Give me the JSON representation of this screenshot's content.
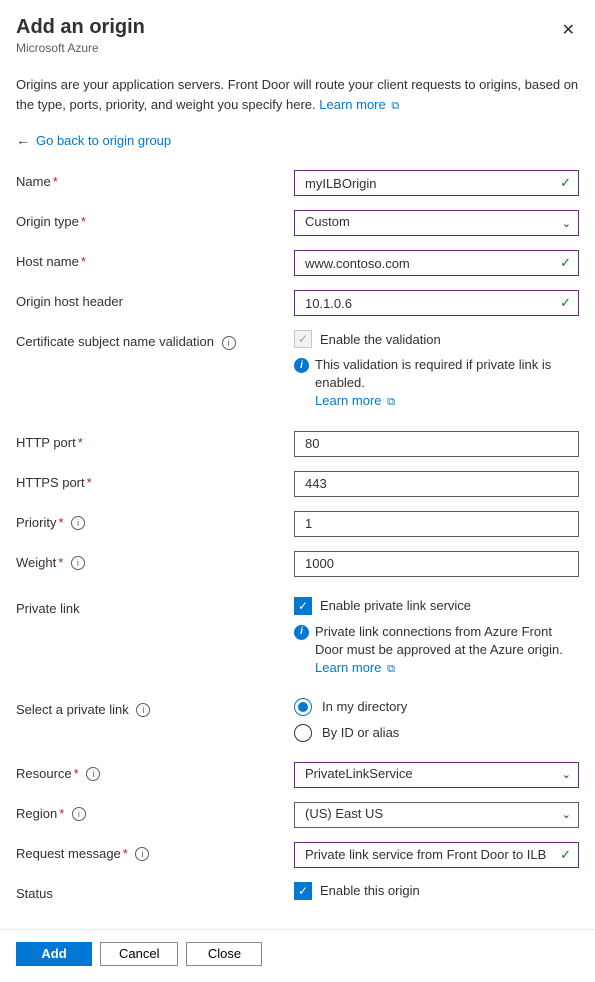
{
  "header": {
    "title": "Add an origin",
    "subtitle": "Microsoft Azure"
  },
  "description": {
    "text": "Origins are your application servers. Front Door will route your client requests to origins, based on the type, ports, priority, and weight you specify here.",
    "learn_more": "Learn more"
  },
  "back_link": "Go back to origin group",
  "fields": {
    "name": {
      "label": "Name",
      "value": "myILBOrigin"
    },
    "origin_type": {
      "label": "Origin type",
      "value": "Custom"
    },
    "host_name": {
      "label": "Host name",
      "value": "www.contoso.com"
    },
    "origin_host_header": {
      "label": "Origin host header",
      "value": "10.1.0.6"
    },
    "cert_validation": {
      "label": "Certificate subject name validation",
      "checkbox": "Enable the validation",
      "info": "This validation is required if private link is enabled.",
      "learn_more": "Learn more"
    },
    "http_port": {
      "label": "HTTP port",
      "value": "80"
    },
    "https_port": {
      "label": "HTTPS port",
      "value": "443"
    },
    "priority": {
      "label": "Priority",
      "value": "1"
    },
    "weight": {
      "label": "Weight",
      "value": "1000"
    },
    "private_link": {
      "label": "Private link",
      "checkbox": "Enable private link service",
      "info": "Private link connections from Azure Front Door must be approved at the Azure origin.",
      "learn_more": "Learn more"
    },
    "select_private_link": {
      "label": "Select a private link",
      "option1": "In my directory",
      "option2": "By ID or alias"
    },
    "resource": {
      "label": "Resource",
      "value": "PrivateLinkService"
    },
    "region": {
      "label": "Region",
      "value": "(US) East US"
    },
    "request_message": {
      "label": "Request message",
      "value": "Private link service from Front Door to ILB"
    },
    "status": {
      "label": "Status",
      "checkbox": "Enable this origin"
    }
  },
  "buttons": {
    "add": "Add",
    "cancel": "Cancel",
    "close": "Close"
  }
}
